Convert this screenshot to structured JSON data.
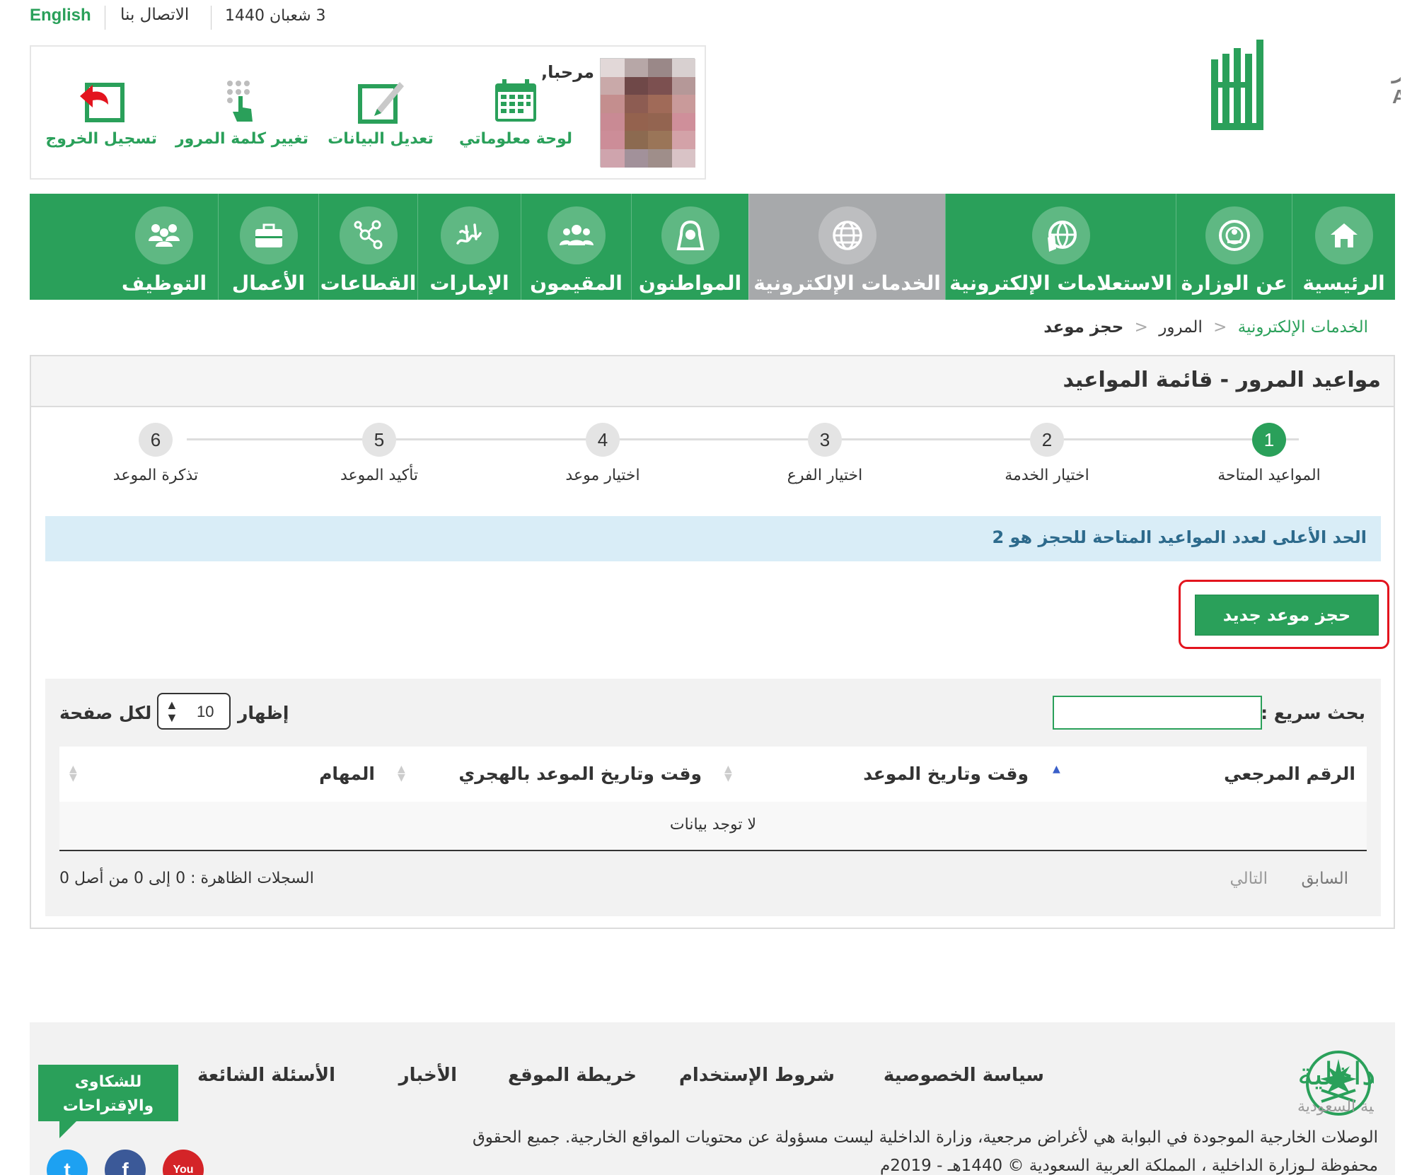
{
  "topbar": {
    "english": "English",
    "contact": "الاتصال بنا",
    "date": "3 شعبان 1440"
  },
  "user": {
    "greeting": "مرحبا,",
    "actions": [
      {
        "label": "لوحة معلوماتي",
        "icon": "calendar-dashboard-icon"
      },
      {
        "label": "تعديل البيانات",
        "icon": "edit-pencil-icon"
      },
      {
        "label": "تغيير كلمة المرور",
        "icon": "keypad-touch-icon"
      },
      {
        "label": "تسجيل الخروج",
        "icon": "logout-arrow-icon"
      }
    ]
  },
  "logo": {
    "arabic": "أبشر",
    "latin": "ABSHER"
  },
  "nav": [
    {
      "label": "الرئيسية",
      "icon": "home-icon"
    },
    {
      "label": "عن الوزارة",
      "icon": "ministry-emblem-icon"
    },
    {
      "label": "الاستعلامات الإلكترونية",
      "icon": "globe-map-icon"
    },
    {
      "label": "الخدمات الإلكترونية",
      "icon": "globe-icon",
      "active": true
    },
    {
      "label": "المواطنون",
      "icon": "citizen-icon"
    },
    {
      "label": "المقيمون",
      "icon": "people-group-icon"
    },
    {
      "label": "الإمارات",
      "icon": "emirates-calligraphy-icon"
    },
    {
      "label": "القطاعات",
      "icon": "network-nodes-icon"
    },
    {
      "label": "الأعمال",
      "icon": "briefcase-icon"
    },
    {
      "label": "التوظيف",
      "icon": "team-icon"
    }
  ],
  "breadcrumb": {
    "level1": "الخدمات الإلكترونية",
    "level2": "المرور",
    "level3": "حجز موعد",
    "chevron": "<"
  },
  "panel": {
    "title": "مواعيد المرور - قائمة المواعيد",
    "steps": [
      {
        "num": "1",
        "label": "المواعيد المتاحة",
        "active": true
      },
      {
        "num": "2",
        "label": "اختيار الخدمة"
      },
      {
        "num": "3",
        "label": "اختيار الفرع"
      },
      {
        "num": "4",
        "label": "اختيار موعد"
      },
      {
        "num": "5",
        "label": "تأكيد الموعد"
      },
      {
        "num": "6",
        "label": "تذكرة الموعد"
      }
    ],
    "notice": "الحد الأعلى لعدد المواعيد المتاحة للحجز هو 2",
    "book_button": "حجز موعد جديد"
  },
  "table": {
    "search_label": "بحث سريع :",
    "show_label": "إظهار",
    "per_page_label": "لكل صفحة",
    "page_length": "10",
    "columns": [
      "الرقم المرجعي",
      "وقت وتاريخ الموعد",
      "وقت وتاريخ الموعد بالهجري",
      "المهام"
    ],
    "empty": "لا توجد بيانات",
    "info": "السجلات الظاهرة : 0 إلى 0 من أصل 0",
    "prev": "السابق",
    "next": "التالي"
  },
  "footer": {
    "moi_name": "وزارة الداخلية",
    "moi_sub": "المملكة العربية السعودية",
    "links": [
      "سياسة الخصوصية",
      "شروط الإستخدام",
      "خريطة الموقع",
      "الأخبار",
      "الأسئلة الشائعة"
    ],
    "complaints": [
      "للشكاوى",
      "والإقتراحات"
    ],
    "copy1": "الوصلات الخارجية الموجودة في البوابة هي لأغراض مرجعية، وزارة الداخلية ليست مسؤولة عن محتويات المواقع الخارجية. جميع الحقوق",
    "copy2": "محفوظة لـوزارة الداخلية ، المملكة العربية السعودية © 1440هـ - 2019م",
    "social": [
      {
        "name": "youtube",
        "label": "You",
        "color": "#d42428"
      },
      {
        "name": "facebook",
        "label": "f",
        "color": "#3b5998"
      },
      {
        "name": "twitter",
        "label": "t",
        "color": "#1da1f2"
      }
    ]
  }
}
